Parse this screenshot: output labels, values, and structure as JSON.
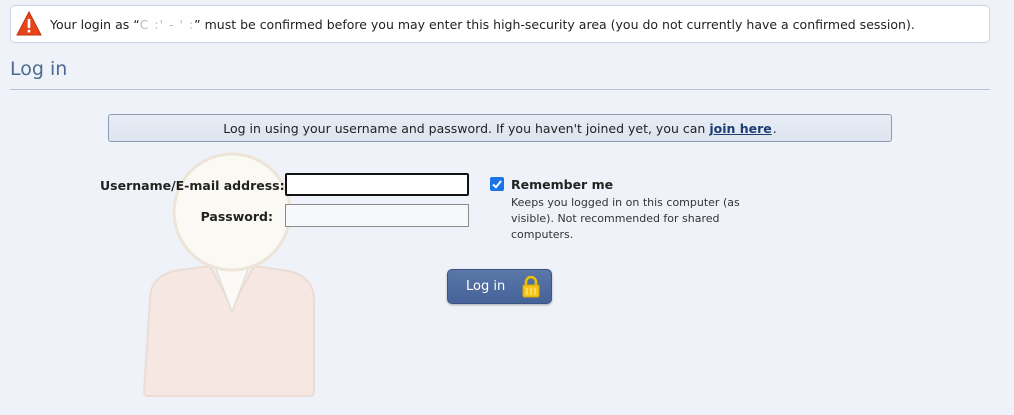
{
  "warning": {
    "prefix": "Your login as “",
    "masked_username": "C  :'  -  '  :",
    "suffix": "” must be confirmed before you may enter this high-security area (you do not currently have a confirmed session).",
    "icon": "warning-triangle-icon",
    "icon_color": "#e8441a"
  },
  "page": {
    "title": "Log in"
  },
  "infobar": {
    "text": "Log in using your username and password. If you haven't joined yet, you can",
    "link": "join here",
    "end": "."
  },
  "form": {
    "username_label": "Username/E-mail address:",
    "username_value": "",
    "password_label": "Password:",
    "password_value": "",
    "remember_label": "Remember me",
    "remember_checked": true,
    "remember_hint": "Keeps you logged in on this computer (as visible). Not recommended for shared computers.",
    "submit_label": "Log in",
    "submit_icon": "padlock-icon"
  },
  "colors": {
    "accent": "#4d6b90",
    "button": "#4f6ea3",
    "checkbox": "#1a73e8",
    "link": "#1c3d73"
  }
}
